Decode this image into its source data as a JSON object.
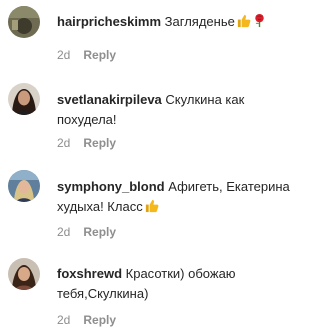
{
  "comments": [
    {
      "username": "hairpricheskimm",
      "text": "Загляденье",
      "emojis": [
        "thumbs-up-icon",
        "rose-icon"
      ],
      "time": "2d",
      "reply_label": "Reply"
    },
    {
      "username": "svetlanakirpileva",
      "text": "Скулкина как похудела!",
      "emojis": [],
      "time": "2d",
      "reply_label": "Reply"
    },
    {
      "username": "symphony_blond",
      "text": "Афигеть, Екатерина худыха! Класс",
      "emojis": [
        "thumbs-up-icon"
      ],
      "time": "2d",
      "reply_label": "Reply"
    },
    {
      "username": "foxshrewd",
      "text": "Красотки) обожаю тебя,Скулкина)",
      "emojis": [],
      "time": "2d",
      "reply_label": "Reply"
    }
  ],
  "colors": {
    "text": "#262626",
    "meta": "#8e8e8e",
    "thumb": "#f5b81c",
    "rose": "#d81e2a"
  }
}
